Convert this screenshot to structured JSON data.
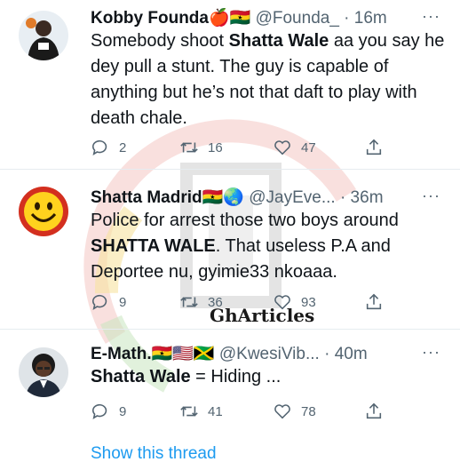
{
  "tweets": [
    {
      "name": "Kobby Founda",
      "name_extra": "🍎🇬🇭",
      "handle": "@Founda_",
      "time": "· 16m",
      "text_parts": [
        "Somebody shoot ",
        "Shatta Wale",
        " aa you say he dey pull a stunt. The guy is capable of anything but he’s not that daft to play with death chale."
      ],
      "replies": "2",
      "retweets": "16",
      "likes": "47"
    },
    {
      "name": "Shatta Madrid",
      "name_extra": "🇬🇭🌏",
      "handle": "@JayEve...",
      "time": "· 36m",
      "text_parts": [
        "Police for arrest those two boys around ",
        "SHATTA WALE",
        ". That useless P.A and Deportee nu, gyimie33 nkoaaa."
      ],
      "replies": "9",
      "retweets": "36",
      "likes": "93"
    },
    {
      "name": "E-Math.",
      "name_extra": "🇬🇭🇺🇸🇯🇲",
      "handle": "@KwesiVib...",
      "time": "· 40m",
      "text_parts": [
        "Shatta Wale",
        " = Hiding ..."
      ],
      "replies": "9",
      "retweets": "41",
      "likes": "78"
    }
  ],
  "menu_glyph": "···",
  "show_thread": "Show this thread",
  "watermark": "GhArticles",
  "colors": {
    "link": "#1d9bf0",
    "muted": "#536471",
    "text": "#0f1419"
  }
}
